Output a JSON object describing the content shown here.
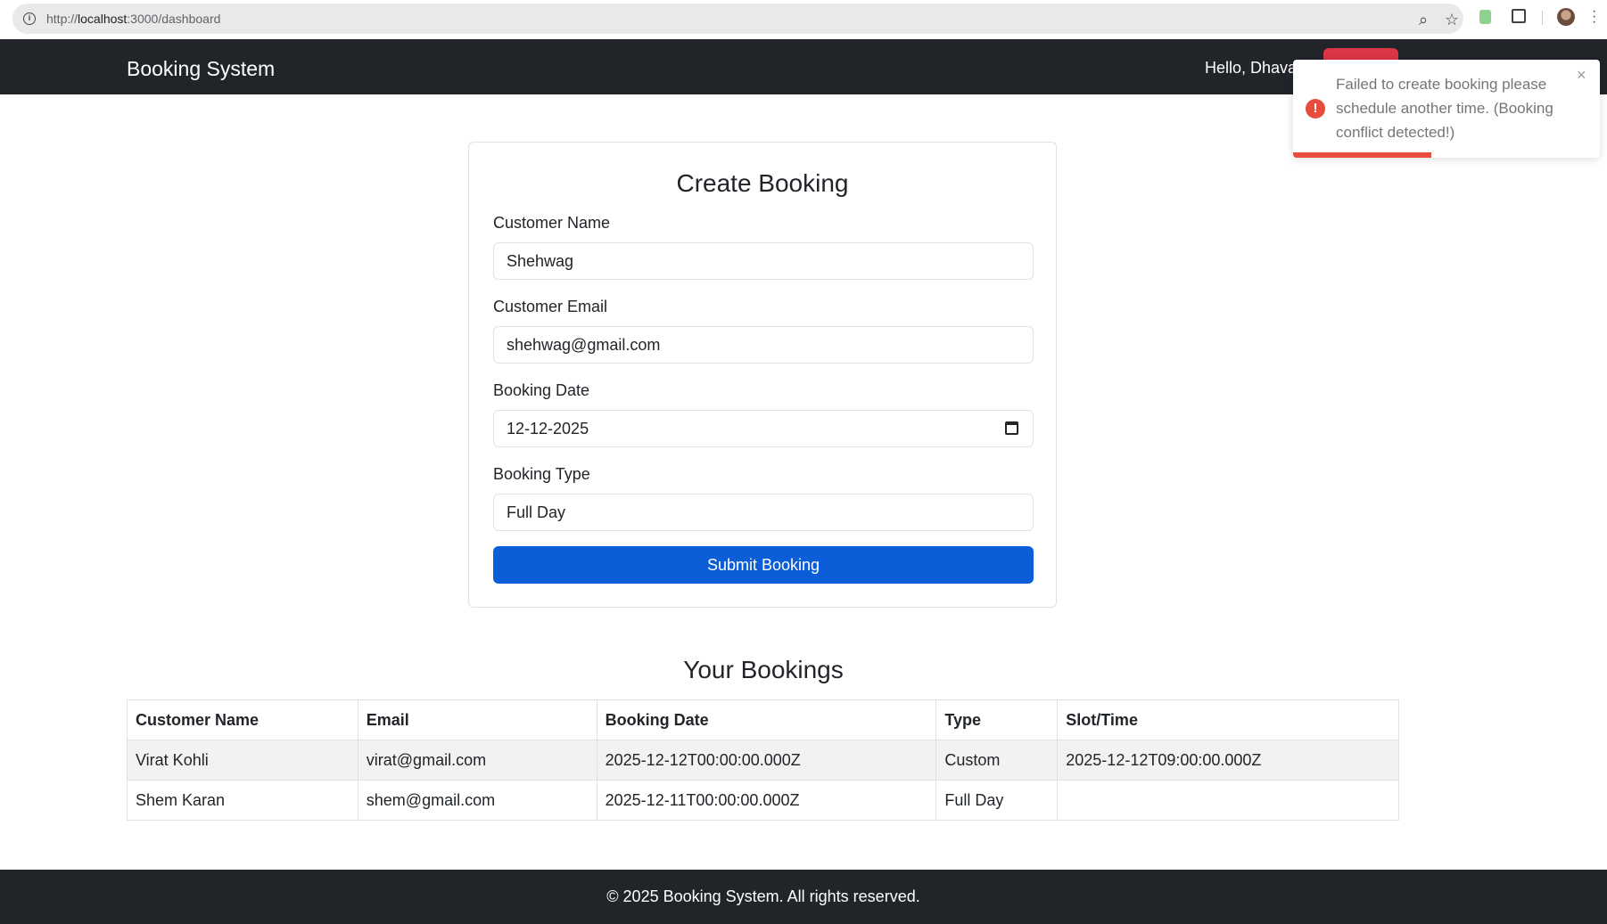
{
  "browser": {
    "url_prefix": "http://",
    "url_host": "localhost",
    "url_rest": ":3000/dashboard",
    "icons": [
      "info-icon",
      "zoom-icon",
      "star-icon",
      "extension-icon",
      "puzzle-icon",
      "profile-avatar",
      "menu-icon"
    ]
  },
  "navbar": {
    "brand": "Booking System",
    "greeting": "Hello, Dhava",
    "bg_color": "#212529",
    "logout_color": "#dc3545"
  },
  "toast": {
    "message": "Failed to create booking please schedule another time. (Booking conflict detected!)",
    "close_symbol": "×",
    "icon_symbol": "!",
    "progress_remaining": 0.45,
    "color": "#e74c3c"
  },
  "form": {
    "title": "Create Booking",
    "name_label": "Customer Name",
    "name_value": "Shehwag",
    "email_label": "Customer Email",
    "email_value": "shehwag@gmail.com",
    "date_label": "Booking Date",
    "date_value": "12-12-2025",
    "type_label": "Booking Type",
    "type_value": "Full Day",
    "submit_label": "Submit Booking",
    "submit_color": "#0b5ed7"
  },
  "bookings": {
    "title": "Your Bookings",
    "columns": [
      "Customer Name",
      "Email",
      "Booking Date",
      "Type",
      "Slot/Time"
    ],
    "rows": [
      [
        "Virat Kohli",
        "virat@gmail.com",
        "2025-12-12T00:00:00.000Z",
        "Custom",
        "2025-12-12T09:00:00.000Z"
      ],
      [
        "Shem Karan",
        "shem@gmail.com",
        "2025-12-11T00:00:00.000Z",
        "Full Day",
        ""
      ]
    ]
  },
  "footer": {
    "text": "© 2025 Booking System. All rights reserved."
  }
}
